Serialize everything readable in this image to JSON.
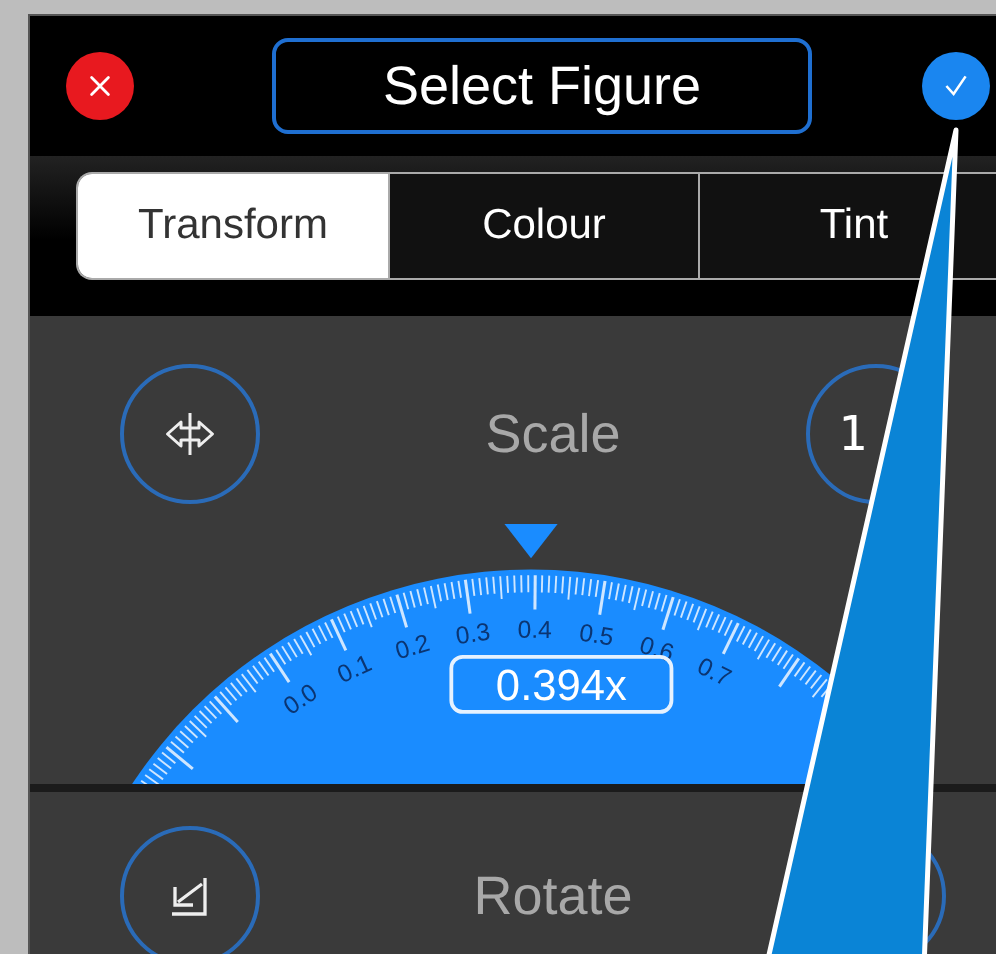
{
  "header": {
    "title": "Select Figure"
  },
  "tabs": [
    {
      "label": "Transform",
      "selected": true
    },
    {
      "label": "Colour",
      "selected": false
    },
    {
      "label": "Tint",
      "selected": false
    }
  ],
  "sections": [
    {
      "kind": "dial",
      "label": "Scale",
      "right_button": "1",
      "reading": "0.394x",
      "tick_labels": [
        "0.0",
        "0.1",
        "0.2",
        "0.3",
        "0.4",
        "0.5",
        "0.6",
        "0.7"
      ]
    },
    {
      "kind": "plain",
      "label": "Rotate"
    }
  ]
}
